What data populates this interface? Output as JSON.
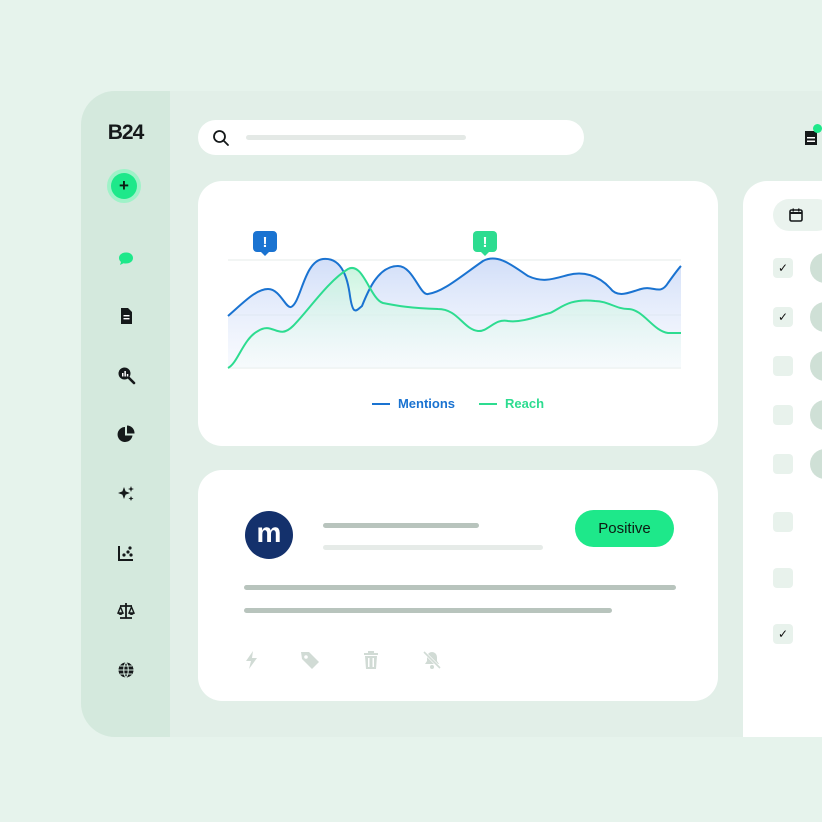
{
  "app": {
    "logo": "B24",
    "add_label": "+"
  },
  "sidebar": {
    "items": [
      {
        "icon": "chat-icon",
        "color": "#1ee88a"
      },
      {
        "icon": "document-icon"
      },
      {
        "icon": "search-analytics-icon"
      },
      {
        "icon": "pie-chart-icon"
      },
      {
        "icon": "sparkles-icon"
      },
      {
        "icon": "scatter-chart-icon"
      },
      {
        "icon": "scales-icon"
      },
      {
        "icon": "globe-icon"
      }
    ]
  },
  "search": {
    "icon": "search-icon"
  },
  "header": {
    "icon": "notifications-icon",
    "dot_color": "#1ee88a"
  },
  "chart_data": {
    "type": "area",
    "title": "",
    "series": [
      {
        "name": "Mentions",
        "color": "#1a73d1",
        "alerts": 1
      },
      {
        "name": "Reach",
        "color": "#2ddc90",
        "alerts": 1
      }
    ],
    "alert_label": "!"
  },
  "post": {
    "avatar_letter": "m",
    "sentiment": "Positive",
    "actions": [
      "lightning-icon",
      "tag-icon",
      "trash-icon",
      "mute-icon"
    ]
  },
  "right_panel": {
    "checkboxes": [
      {
        "checked": true,
        "mark": "✓"
      },
      {
        "checked": true,
        "mark": "✓"
      },
      {
        "checked": false,
        "mark": ""
      },
      {
        "checked": false,
        "mark": ""
      },
      {
        "checked": false,
        "mark": ""
      },
      {
        "checked": false,
        "mark": ""
      },
      {
        "checked": false,
        "mark": ""
      },
      {
        "checked": true,
        "mark": "✓"
      }
    ]
  }
}
